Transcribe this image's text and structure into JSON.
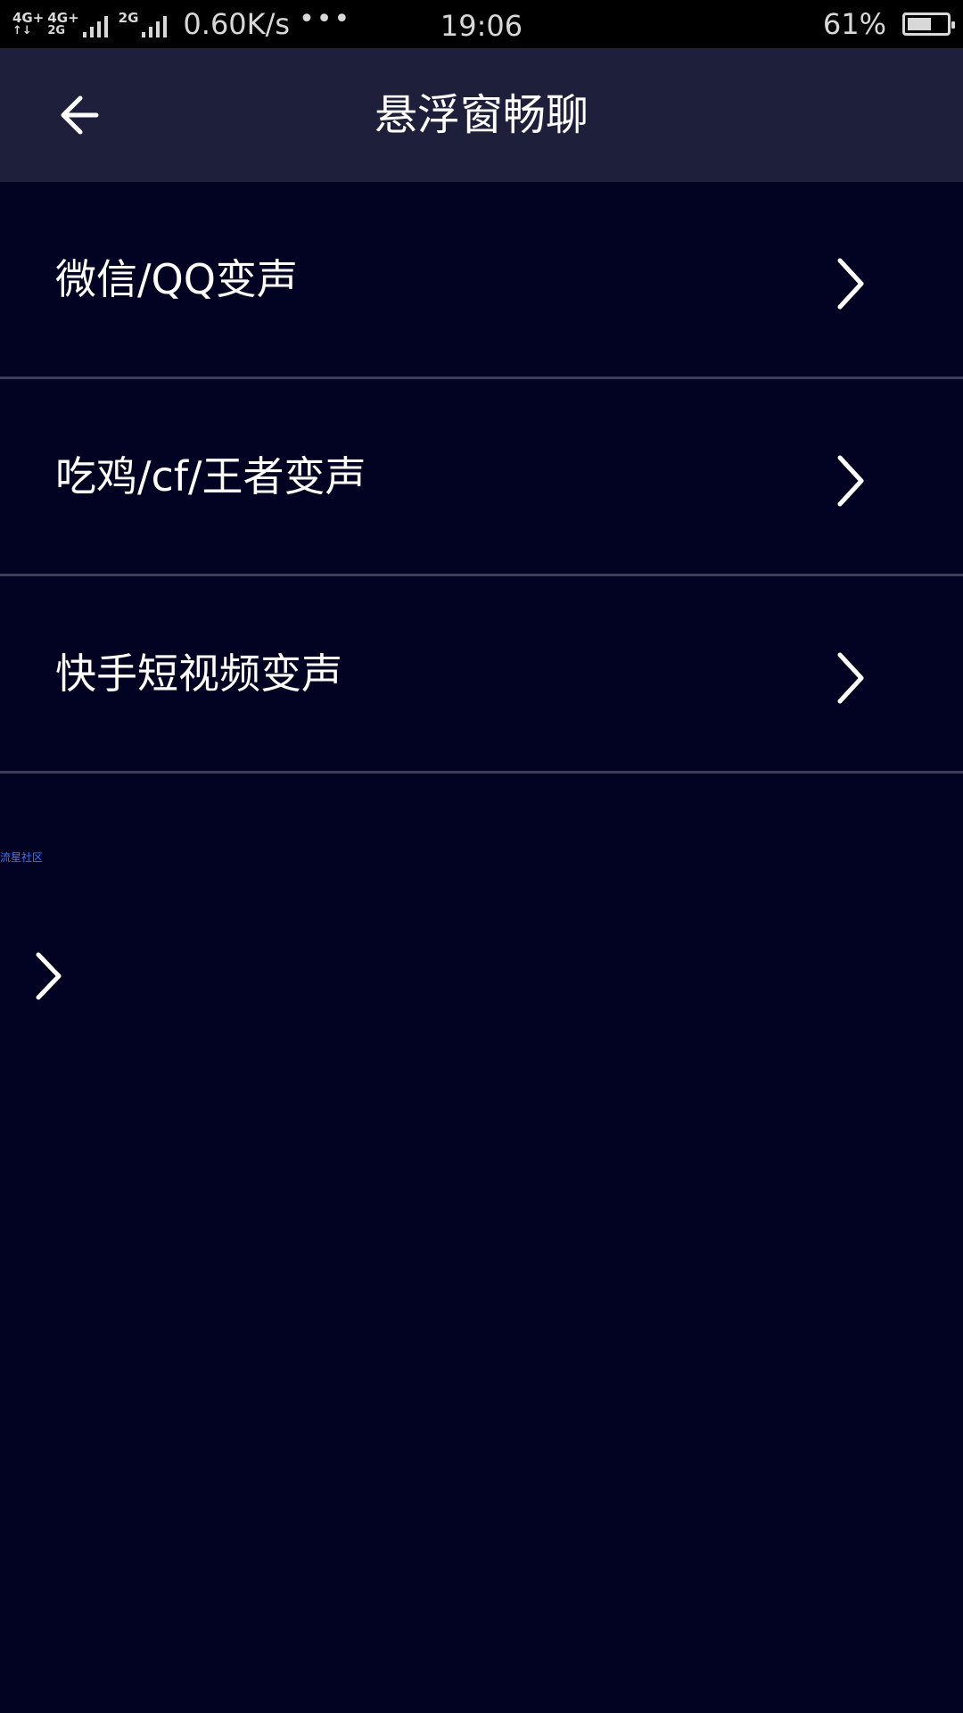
{
  "status_bar": {
    "network_1_top": "4G+",
    "network_1_bottom": "↑↓",
    "network_2_top": "4G+",
    "network_2_bottom": "2G",
    "network_3_top": "2G",
    "speed": "0.60K/s",
    "more": "•••",
    "time": "19:06",
    "battery_percent": "61%",
    "battery_level": 0.61
  },
  "header": {
    "back_icon": "arrow-left-icon",
    "title": "悬浮窗畅聊"
  },
  "menu": {
    "items": [
      {
        "label": "微信/QQ变声",
        "icon": "chevron-right-icon"
      },
      {
        "label": "吃鸡/cf/王者变声",
        "icon": "chevron-right-icon"
      },
      {
        "label": "快手短视频变声",
        "icon": "chevron-right-icon"
      }
    ]
  },
  "floating": {
    "label": "流星社区",
    "icon": "chevron-right-icon"
  },
  "colors": {
    "background": "#020222",
    "header_bg": "#1e1f3b",
    "divider": "#3c3d58",
    "floating_label": "#2f7bff"
  }
}
